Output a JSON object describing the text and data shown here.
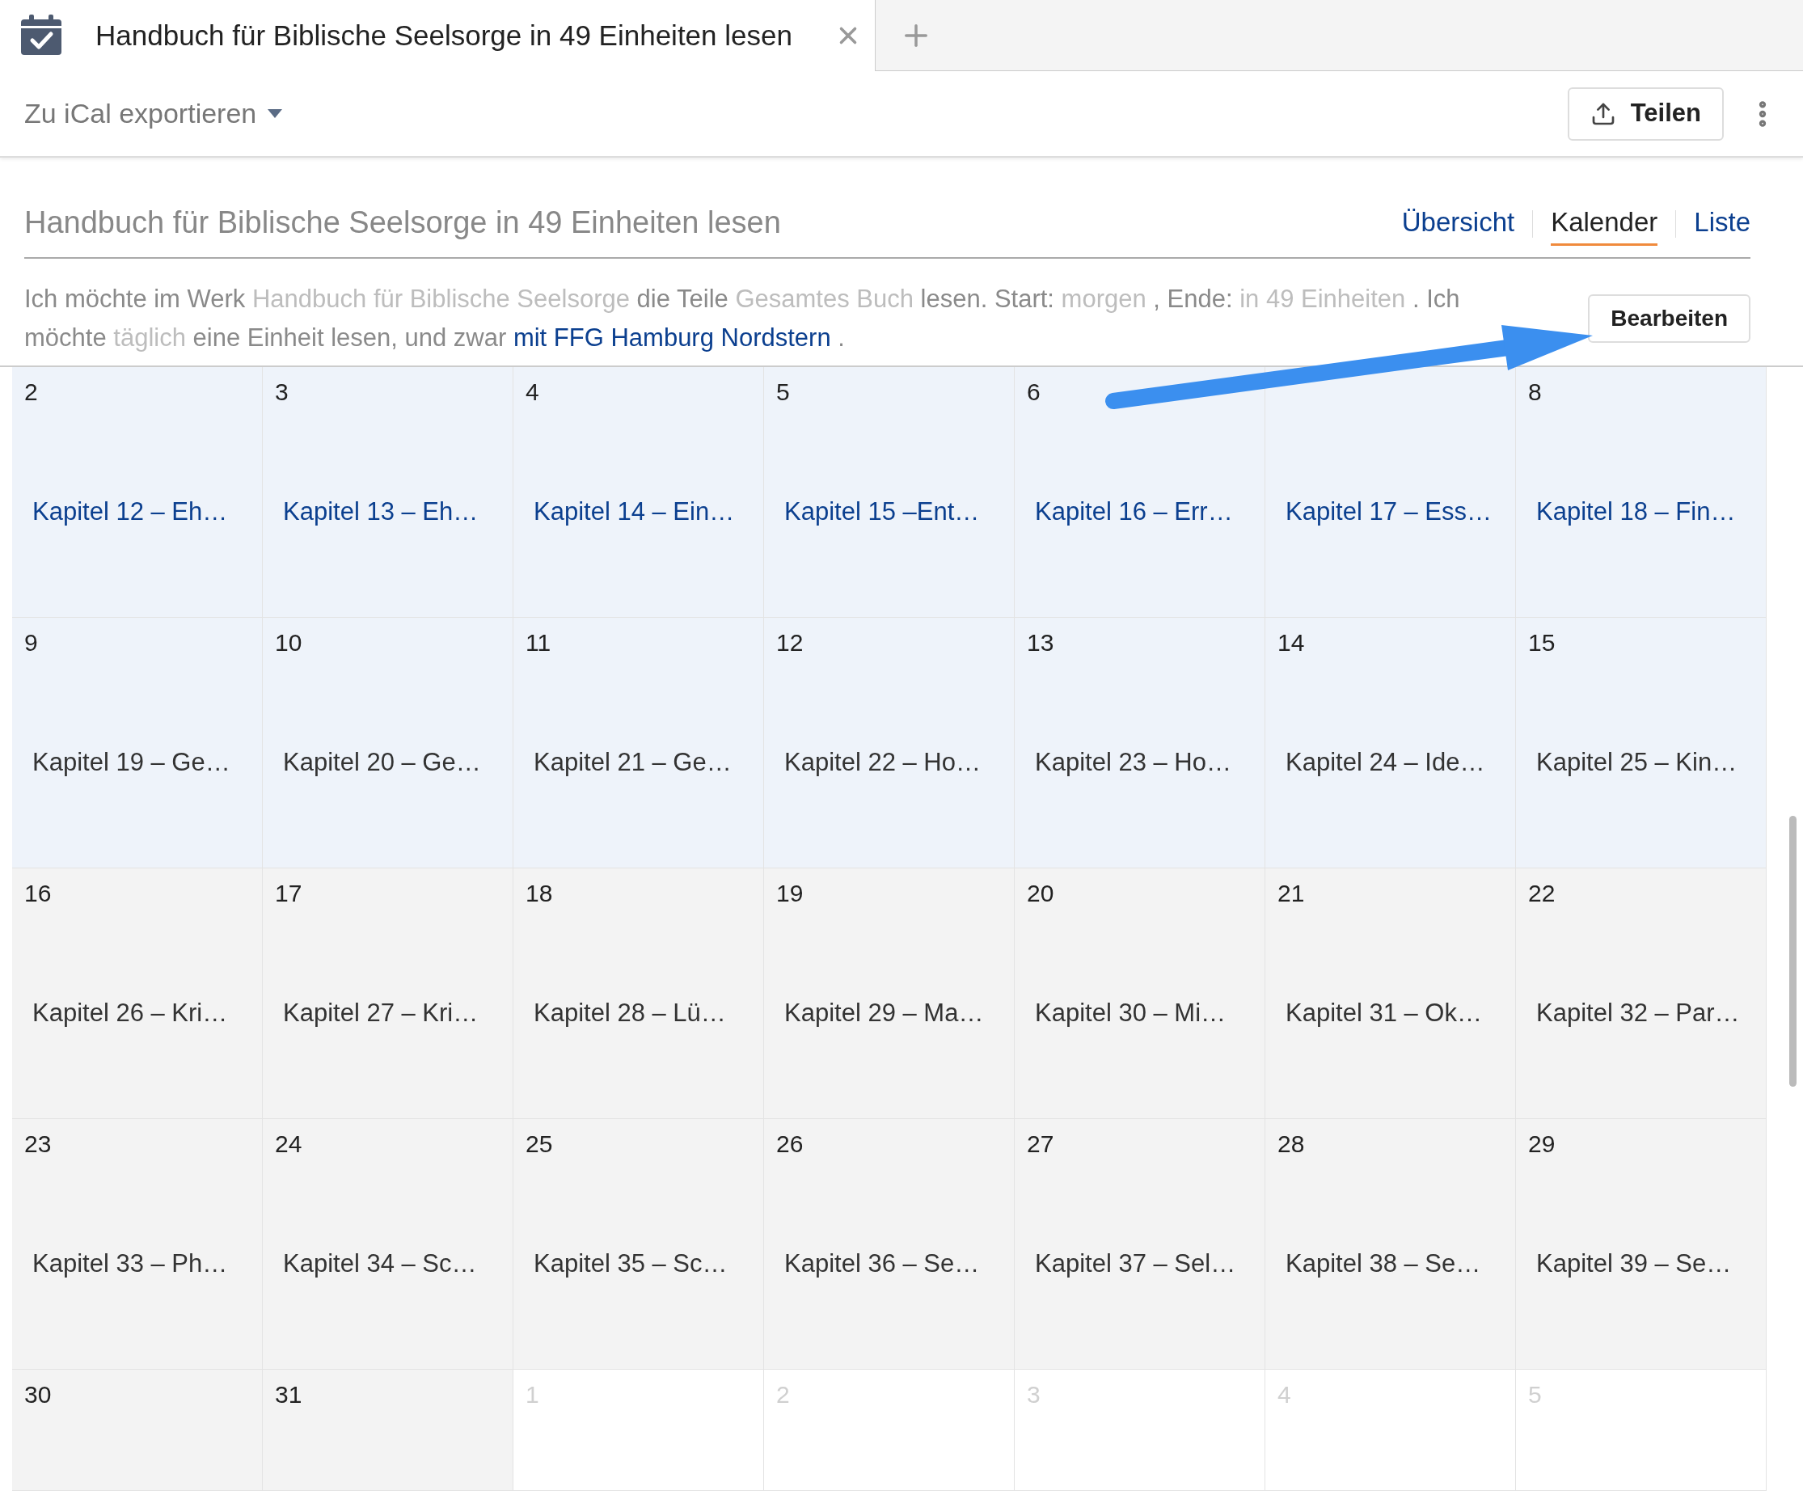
{
  "tab": {
    "title": "Handbuch für Biblische Seelsorge in 49 Einheiten lesen"
  },
  "toolbar": {
    "export_menu": "Zu iCal exportieren",
    "share_button": "Teilen"
  },
  "header": {
    "title": "Handbuch für Biblische Seelsorge in 49 Einheiten lesen",
    "views": [
      {
        "label": "Übersicht",
        "selected": false
      },
      {
        "label": "Kalender",
        "selected": true
      },
      {
        "label": "Liste",
        "selected": false
      }
    ]
  },
  "plan": {
    "segments": [
      {
        "kind": "text",
        "text": "Ich möchte im Werk"
      },
      {
        "kind": "value",
        "text": "Handbuch für Biblische Seelsorge"
      },
      {
        "kind": "text",
        "text": "die Teile"
      },
      {
        "kind": "value",
        "text": "Gesamtes Buch"
      },
      {
        "kind": "text",
        "text": "lesen. Start:"
      },
      {
        "kind": "value",
        "text": "morgen"
      },
      {
        "kind": "text",
        "text": ", Ende:"
      },
      {
        "kind": "value",
        "text": "in 49 Einheiten"
      },
      {
        "kind": "text",
        "text": ". Ich möchte"
      },
      {
        "kind": "value",
        "text": "täglich"
      },
      {
        "kind": "text",
        "text": "eine Einheit lesen, und zwar"
      },
      {
        "kind": "link",
        "text": "mit FFG Hamburg Nordstern"
      },
      {
        "kind": "text",
        "text": "."
      }
    ],
    "edit_button": "Bearbeiten"
  },
  "calendar": {
    "weeks": [
      [
        {
          "day": "2",
          "entry": "Kapitel 12 – Eh…",
          "kind": "link"
        },
        {
          "day": "3",
          "entry": "Kapitel 13 – Eh…",
          "kind": "link"
        },
        {
          "day": "4",
          "entry": "Kapitel 14 – Ein…",
          "kind": "link"
        },
        {
          "day": "5",
          "entry": "Kapitel 15 –Ent…",
          "kind": "link"
        },
        {
          "day": "6",
          "entry": "Kapitel 16 – Err…",
          "kind": "link"
        },
        {
          "entry": "Kapitel 17 – Ess…",
          "kind": "link"
        },
        {
          "day": "8",
          "entry": "Kapitel 18 – Fin…",
          "kind": "link"
        }
      ],
      [
        {
          "day": "9",
          "entry": "Kapitel 19 – Ge…",
          "kind": "week"
        },
        {
          "day": "10",
          "entry": "Kapitel 20 – Ge…",
          "kind": "week"
        },
        {
          "day": "11",
          "entry": "Kapitel 21 – Ge…",
          "kind": "week"
        },
        {
          "day": "12",
          "entry": "Kapitel 22 – Ho…",
          "kind": "week"
        },
        {
          "day": "13",
          "entry": "Kapitel 23 – Ho…",
          "kind": "week"
        },
        {
          "day": "14",
          "entry": "Kapitel 24 – Ide…",
          "kind": "week"
        },
        {
          "day": "15",
          "entry": "Kapitel 25 – Kin…",
          "kind": "week"
        }
      ],
      [
        {
          "day": "16",
          "entry": "Kapitel 26 – Kri…",
          "kind": "month"
        },
        {
          "day": "17",
          "entry": "Kapitel 27 – Kri…",
          "kind": "month"
        },
        {
          "day": "18",
          "entry": "Kapitel 28 – Lü…",
          "kind": "month"
        },
        {
          "day": "19",
          "entry": "Kapitel 29 – Ma…",
          "kind": "month"
        },
        {
          "day": "20",
          "entry": "Kapitel 30 – Mi…",
          "kind": "month"
        },
        {
          "day": "21",
          "entry": "Kapitel 31 – Ok…",
          "kind": "month"
        },
        {
          "day": "22",
          "entry": "Kapitel 32 – Par…",
          "kind": "month"
        }
      ],
      [
        {
          "day": "23",
          "entry": "Kapitel 33 – Ph…",
          "kind": "month"
        },
        {
          "day": "24",
          "entry": "Kapitel 34 – Sc…",
          "kind": "month"
        },
        {
          "day": "25",
          "entry": "Kapitel 35 – Sc…",
          "kind": "month"
        },
        {
          "day": "26",
          "entry": "Kapitel 36 – Se…",
          "kind": "month"
        },
        {
          "day": "27",
          "entry": "Kapitel 37 – Sel…",
          "kind": "month"
        },
        {
          "day": "28",
          "entry": "Kapitel 38 – Se…",
          "kind": "month"
        },
        {
          "day": "29",
          "entry": "Kapitel 39 – Se…",
          "kind": "month"
        }
      ],
      [
        {
          "day": "30",
          "kind": "month"
        },
        {
          "day": "31",
          "kind": "month"
        },
        {
          "day": "1",
          "kind": "outside"
        },
        {
          "day": "2",
          "kind": "outside"
        },
        {
          "day": "3",
          "kind": "outside"
        },
        {
          "day": "4",
          "kind": "outside"
        },
        {
          "day": "5",
          "kind": "outside"
        }
      ]
    ]
  }
}
